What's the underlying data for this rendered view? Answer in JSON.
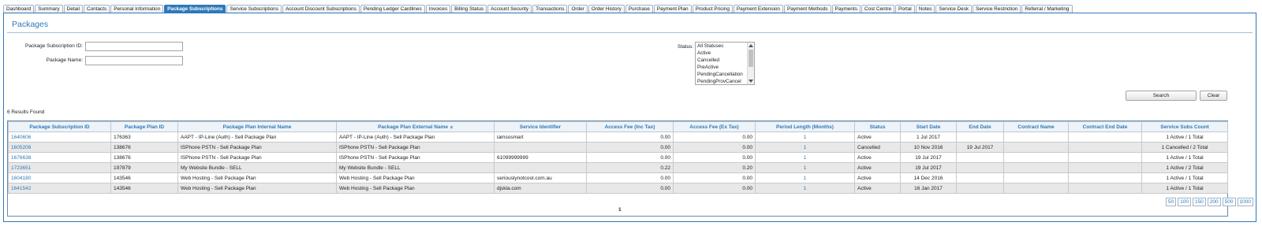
{
  "tabs": [
    "Dashboard",
    "Summary",
    "Detail",
    "Contacts",
    "Personal Information",
    "Package Subscriptions",
    "Service Subscriptions",
    "Account Discount Subscriptions",
    "Pending Ledger Cardlines",
    "Invoices",
    "Billing Status",
    "Account Security",
    "Transactions",
    "Order",
    "Order History",
    "Purchase",
    "Payment Plan",
    "Product Pricing",
    "Payment Extension",
    "Payment Methods",
    "Payments",
    "Cost Centre",
    "Portal",
    "Notes",
    "Service Desk",
    "Service Restriction",
    "Referral / Marketing"
  ],
  "active_tab": "Package Subscriptions",
  "panel": {
    "title": "Packages",
    "subscription_id_label": "Package Subscription ID:",
    "subscription_id_value": "",
    "package_name_label": "Package Name:",
    "package_name_value": "",
    "status_label": "Status:",
    "status_options": [
      "All Statuses",
      "Active",
      "Cancelled",
      "PreActive",
      "PendingCancellation",
      "PendingProvCancel"
    ],
    "results_found": "6 Results Found",
    "search_button": "Search",
    "clear_button": "Clear"
  },
  "table": {
    "headers": [
      "Package Subscription ID",
      "Package Plan ID",
      "Package Plan Internal Name",
      "Package Plan External Name",
      "Service Identifier",
      "Access Fee (Inc Tax)",
      "Access Fee (Ex Tax)",
      "Period Length (Months)",
      "Status",
      "Start Date",
      "End Date",
      "Contract Name",
      "Contract End Date",
      "Service Subs Count"
    ],
    "sort_icon": "double-chevron-down-icon",
    "rows": [
      [
        "1640606",
        "176363",
        "AAPT - IP-Line (Auth) - Sell Package Plan",
        "AAPT - IP-Line (Auth) - Sell Package Plan",
        "iamsosmart",
        "0.00",
        "0.00",
        "1",
        "Active",
        "1 Jul 2017",
        "",
        "",
        "",
        "1 Active / 1 Total"
      ],
      [
        "1605208",
        "138676",
        "ISPhone PSTN - Sell Package Plan",
        "ISPhone PSTN - Sell Package Plan",
        "",
        "0.00",
        "0.00",
        "1",
        "Cancelled",
        "10 Nov 2016",
        "19 Jul 2017",
        "",
        "",
        "1 Cancelled / 2 Total"
      ],
      [
        "1676638",
        "138676",
        "ISPhone PSTN - Sell Package Plan",
        "ISPhone PSTN - Sell Package Plan",
        "61099999999",
        "0.00",
        "0.00",
        "1",
        "Active",
        "19 Jul 2017",
        "",
        "",
        "",
        "1 Active / 1 Total"
      ],
      [
        "1723651",
        "197879",
        "My Website Bundle - SELL",
        "My Website Bundle - SELL",
        "",
        "0.22",
        "0.20",
        "1",
        "Active",
        "19 Jul 2017",
        "",
        "",
        "",
        "1 Active / 2 Total"
      ],
      [
        "1604180",
        "143546",
        "Web Hosting - Sell Package Plan",
        "Web Hosting - Sell Package Plan",
        "seriouslynotcool.com.au",
        "0.00",
        "0.00",
        "1",
        "Active",
        "14 Dec 2016",
        "",
        "",
        "",
        "1 Active / 1 Total"
      ],
      [
        "1641542",
        "143546",
        "Web Hosting - Sell Package Plan",
        "Web Hosting - Sell Package Plan",
        "djskla.com",
        "0.00",
        "0.00",
        "1",
        "Active",
        "16 Jan 2017",
        "",
        "",
        "",
        "1 Active / 1 Total"
      ]
    ]
  },
  "pager": {
    "current_page": "1",
    "page_sizes": [
      "50",
      "100",
      "150",
      "200",
      "500",
      "1000"
    ]
  },
  "colors": {
    "accent": "#2e79b9"
  }
}
